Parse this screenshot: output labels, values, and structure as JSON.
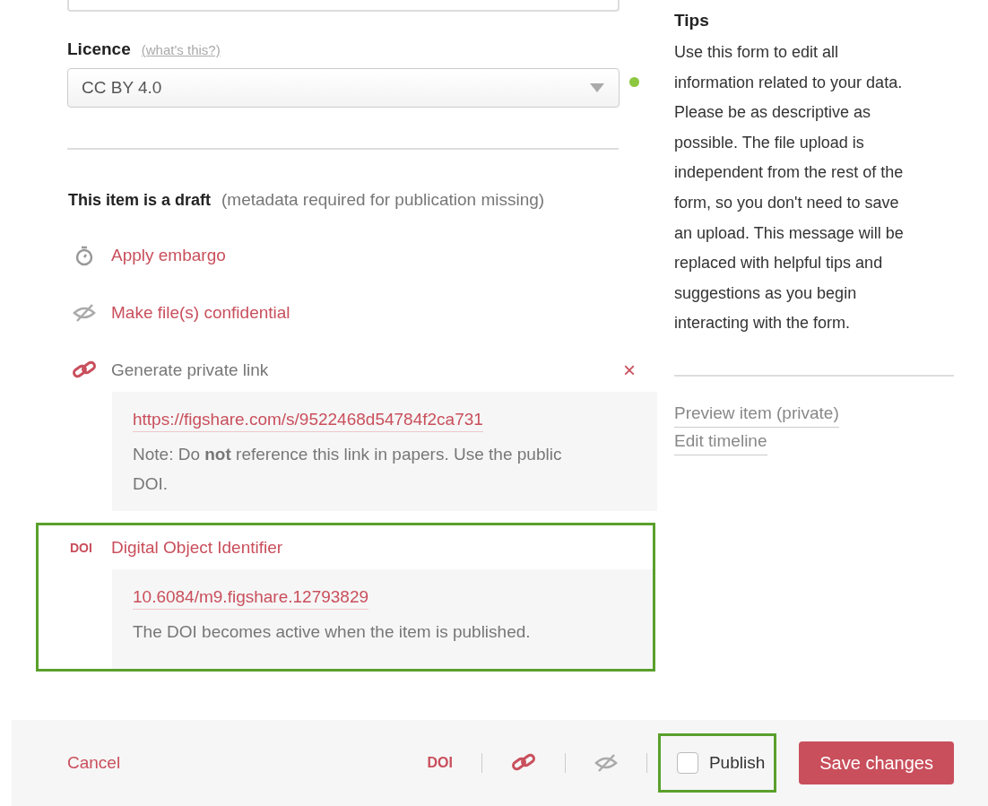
{
  "licence": {
    "label": "Licence",
    "help_link": "(what's this?)",
    "value": "CC BY 4.0",
    "valid": true
  },
  "draft": {
    "title": "This item is a draft",
    "note": "(metadata required for publication missing)"
  },
  "actions": [
    {
      "kind": "embargo",
      "label": "Apply embargo",
      "active": false
    },
    {
      "kind": "confidential",
      "label": "Make file(s) confidential",
      "active": false
    },
    {
      "kind": "private_link",
      "label": "Generate private link",
      "active": true,
      "close": "×",
      "link": "https://figshare.com/s/9522468d54784f2ca731",
      "note": "Note: Do **not** reference this link in papers. Use the public DOI.",
      "highlighted": false
    },
    {
      "kind": "doi",
      "icon_text": "DOI",
      "label": "Digital Object Identifier",
      "active": false,
      "link": "10.6084/m9.figshare.12793829",
      "note": "The DOI becomes active when the item is published.",
      "highlighted": true
    }
  ],
  "tips": {
    "title": "Tips",
    "text": "Use this form to edit all information related to your data. Please be as descriptive as possible. The file upload is independent from the rest of the form, so you don't need to save an upload. This message will be replaced with helpful tips and suggestions as you begin interacting with the form."
  },
  "side_links": [
    "Preview item (private)",
    "Edit timeline"
  ],
  "footer": {
    "cancel": "Cancel",
    "doi_text": "DOI",
    "publish": {
      "label": "Publish",
      "checked": false,
      "highlighted": true
    },
    "save": "Save changes"
  }
}
